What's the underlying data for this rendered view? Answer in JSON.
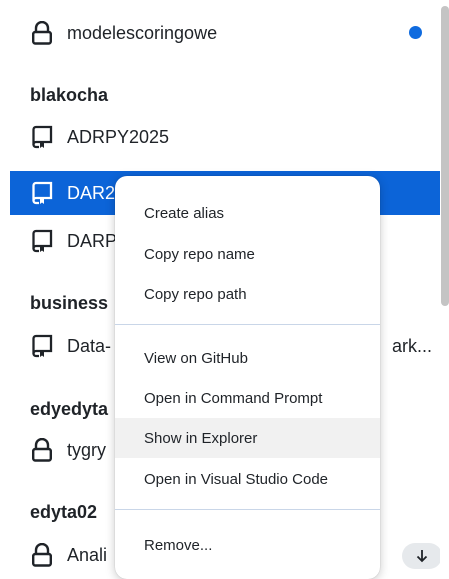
{
  "repo_list": {
    "groups": [
      {
        "name": "blakocha"
      },
      {
        "name": "business"
      },
      {
        "name": "edyedyta"
      },
      {
        "name": "edyta02"
      }
    ],
    "items": [
      {
        "label": "modelescoringowe",
        "icon": "lock-icon"
      },
      {
        "label": "ADRPY2025",
        "icon": "repo-icon"
      },
      {
        "label": "DAR2",
        "icon": "repo-icon",
        "selected": true
      },
      {
        "label": "DARP",
        "icon": "repo-icon"
      },
      {
        "label": "Data-",
        "icon": "repo-icon",
        "trailing": "ark..."
      },
      {
        "label": "tygry",
        "icon": "lock-icon"
      },
      {
        "label": "Anali",
        "icon": "lock-icon"
      }
    ]
  },
  "context_menu": {
    "items": [
      {
        "label": "Create alias"
      },
      {
        "label": "Copy repo name"
      },
      {
        "label": "Copy repo path"
      },
      {
        "label": "View on GitHub"
      },
      {
        "label": "Open in Command Prompt"
      },
      {
        "label": "Show in Explorer",
        "hovered": true
      },
      {
        "label": "Open in Visual Studio Code"
      },
      {
        "label": "Remove..."
      }
    ]
  },
  "colors": {
    "selected_row": "#0c64d8",
    "changes_dot": "#0f6bdf",
    "menu_hover": "#f1f1f1",
    "separator": "#c9d6e8"
  }
}
